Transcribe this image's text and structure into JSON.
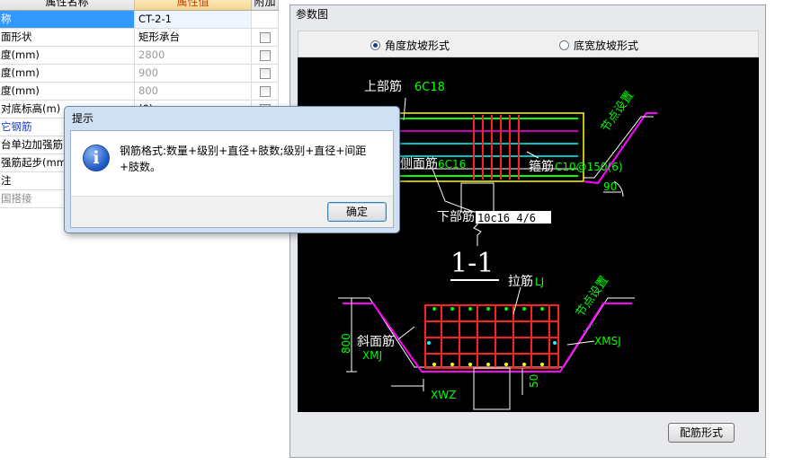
{
  "grid": {
    "headers": {
      "name": "属性名称",
      "value": "属性值",
      "attach": "附加"
    },
    "rows": [
      {
        "name": "称",
        "value": "CT-2-1",
        "check": false
      },
      {
        "name": "面形状",
        "value": "矩形承台",
        "check": true
      },
      {
        "name": "度(mm)",
        "value": "2800",
        "check": true
      },
      {
        "name": "度(mm)",
        "value": "900",
        "check": true
      },
      {
        "name": "度(mm)",
        "value": "800",
        "check": true
      },
      {
        "name": "对底标高(m)",
        "value": "(0)",
        "check": true
      },
      {
        "name": "它钢筋",
        "value": "",
        "check": false
      },
      {
        "name": "台单边加强筋",
        "value": "",
        "check": false
      },
      {
        "name": "强筋起步(mm)",
        "value": "",
        "check": false
      },
      {
        "name": "注",
        "value": "",
        "check": false
      },
      {
        "name": "国搭接",
        "value": "",
        "check": false
      }
    ]
  },
  "panel": {
    "title": "参数图",
    "radio_angle": "角度放坡形式",
    "radio_width": "底宽放坡形式",
    "rebar_button": "配筋形式"
  },
  "drawing": {
    "top_label": "上部筋",
    "top_value": "6C18",
    "side_label": "侧面筋",
    "side_value": "6C16",
    "stirrup_label": "箍筋",
    "stirrup_value": "C10@150(6)",
    "bottom_label": "下部筋",
    "bottom_value": "10c16 4/6",
    "node_setting": "节点设置",
    "angle_value": "90",
    "section": "1-1",
    "tie_label": "拉筋",
    "tie_value": "LJ",
    "slope_label": "斜面筋",
    "slope_value": "XMJ",
    "dim_800": "800",
    "dim_50": "50",
    "xwz": "XWZ",
    "xmsj": "XMSJ",
    "colors": {
      "yellow": "#ffff00",
      "green": "#00ff00",
      "cyan": "#00ffff",
      "red": "#ff2020",
      "magenta": "#ff00ff",
      "white": "#ffffff"
    }
  },
  "dialog": {
    "title": "提示",
    "icon": "info-icon",
    "message": "钢筋格式:数量+级别+直径+肢数;级别+直径+间距+肢数。",
    "ok": "确定"
  }
}
